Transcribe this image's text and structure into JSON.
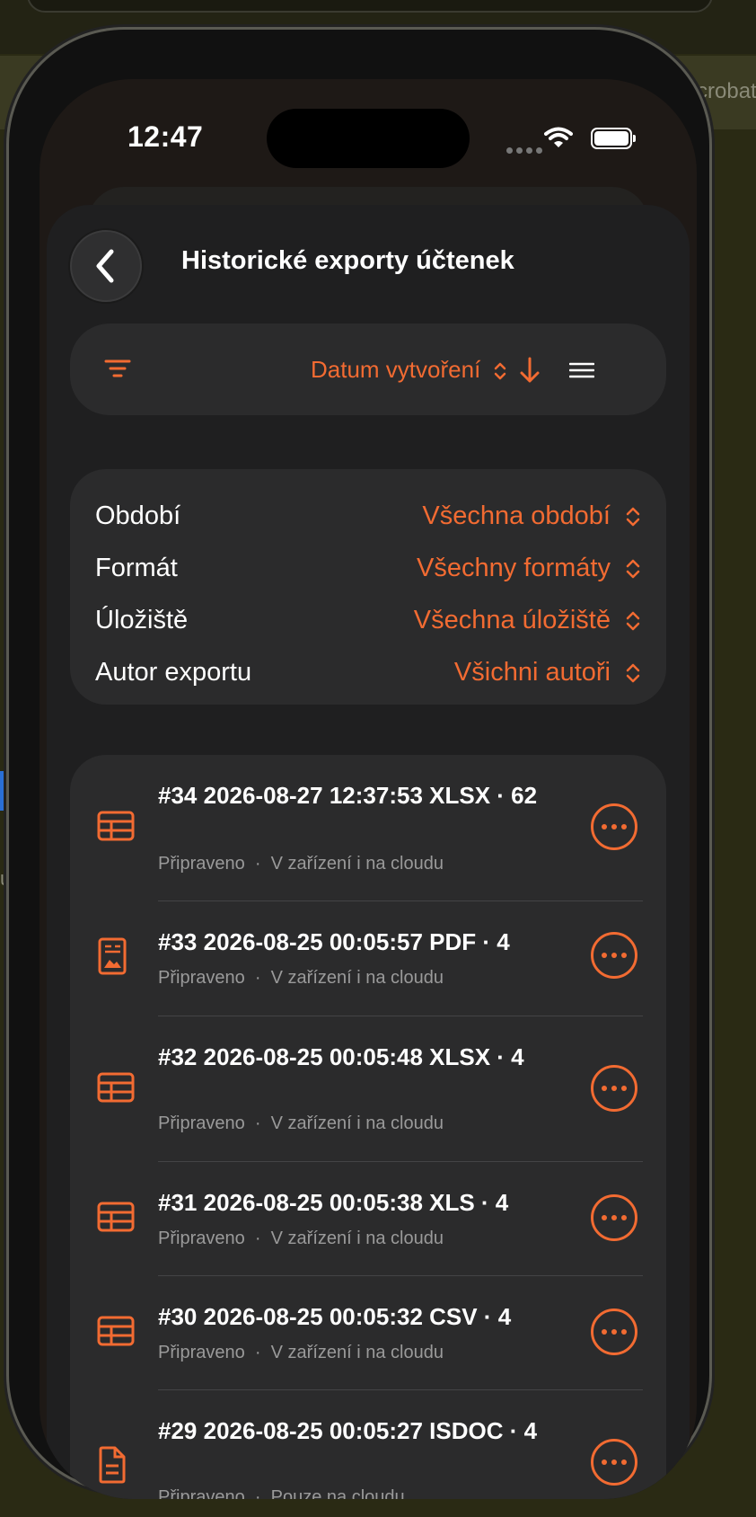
{
  "colors": {
    "accent": "#f26b32",
    "background": "#1f1f20",
    "card": "#2b2b2c"
  },
  "desktop": {
    "right_text": "crobat",
    "left_text": "u"
  },
  "status_bar": {
    "time": "12:47"
  },
  "header": {
    "title": "Historické exporty účtenek",
    "back_icon": "chevron-left-icon"
  },
  "toolbar": {
    "sort_label": "Datum vytvoření",
    "filter_icon": "filter-icon",
    "sort_direction_icon": "arrow-down-icon",
    "menu_icon": "menu-icon"
  },
  "filters": [
    {
      "label": "Období",
      "value": "Všechna období"
    },
    {
      "label": "Formát",
      "value": "Všechny formáty"
    },
    {
      "label": "Úložiště",
      "value": "Všechna úložiště"
    },
    {
      "label": "Autor exportu",
      "value": "Všichni autoři"
    }
  ],
  "exports": [
    {
      "title": "#34 2026-08-27 12:37:53 XLSX · 62",
      "status": "Připraveno",
      "storage": "V zařízení i na cloudu",
      "icon": "table-icon"
    },
    {
      "title": "#33 2026-08-25 00:05:57 PDF · 4",
      "status": "Připraveno",
      "storage": "V zařízení i na cloudu",
      "icon": "pdf-document-icon"
    },
    {
      "title": "#32 2026-08-25 00:05:48 XLSX · 4",
      "status": "Připraveno",
      "storage": "V zařízení i na cloudu",
      "icon": "table-icon"
    },
    {
      "title": "#31 2026-08-25 00:05:38 XLS · 4",
      "status": "Připraveno",
      "storage": "V zařízení i na cloudu",
      "icon": "table-icon"
    },
    {
      "title": "#30 2026-08-25 00:05:32 CSV · 4",
      "status": "Připraveno",
      "storage": "V zařízení i na cloudu",
      "icon": "table-icon"
    },
    {
      "title": "#29 2026-08-25 00:05:27 ISDOC · 4",
      "status": "Připraveno",
      "storage": "Pouze na cloudu",
      "icon": "document-icon"
    }
  ],
  "separator": "·"
}
